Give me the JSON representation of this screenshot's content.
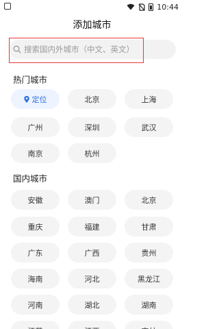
{
  "status_bar": {
    "time": "10:44"
  },
  "header": {
    "title": "添加城市"
  },
  "search": {
    "placeholder": "搜索国内外城市（中文、英文）"
  },
  "hot_cities": {
    "title": "热门城市",
    "locate_label": "定位",
    "items": [
      "北京",
      "上海",
      "广州",
      "深圳",
      "武汉",
      "南京",
      "杭州"
    ]
  },
  "domestic_cities": {
    "title": "国内城市",
    "items": [
      "安徽",
      "澳门",
      "北京",
      "重庆",
      "福建",
      "甘肃",
      "广东",
      "广西",
      "贵州",
      "海南",
      "河北",
      "黑龙江",
      "河南",
      "湖北",
      "湖南",
      "江苏",
      "江西",
      "吉林"
    ]
  },
  "colors": {
    "accent": "#2f6fe4",
    "highlight_box": "#e53935",
    "chip_bg": "#f4f4f4"
  }
}
